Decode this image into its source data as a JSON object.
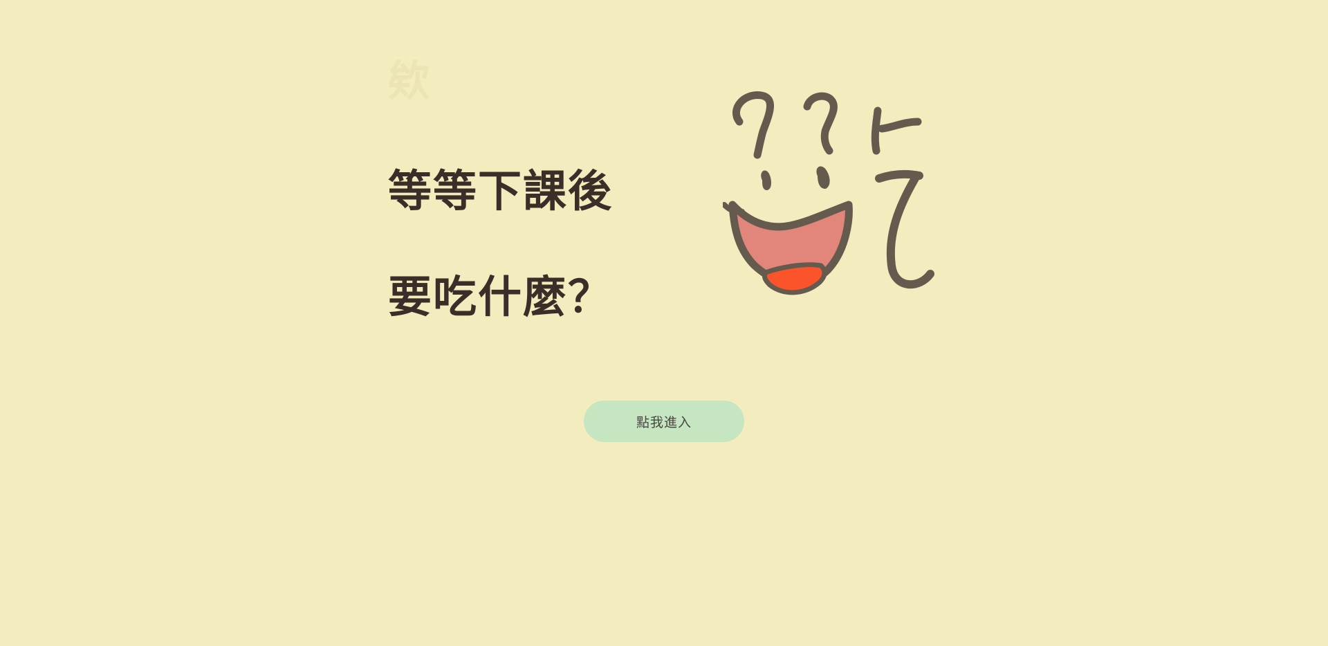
{
  "watermark": {
    "text": "欸"
  },
  "headline": {
    "line1": "等等下課後",
    "line2": "要吃什麼？"
  },
  "illustration": {
    "name": "laughing-face-icon",
    "colors": {
      "ink": "#655a4e",
      "mouth": "#e2857b",
      "tongue": "#fb542b"
    }
  },
  "enter_button": {
    "label": "點我進入"
  },
  "colors": {
    "background": "#f3ecbe",
    "text": "#3a2e28",
    "button": "#c5e6c0"
  }
}
